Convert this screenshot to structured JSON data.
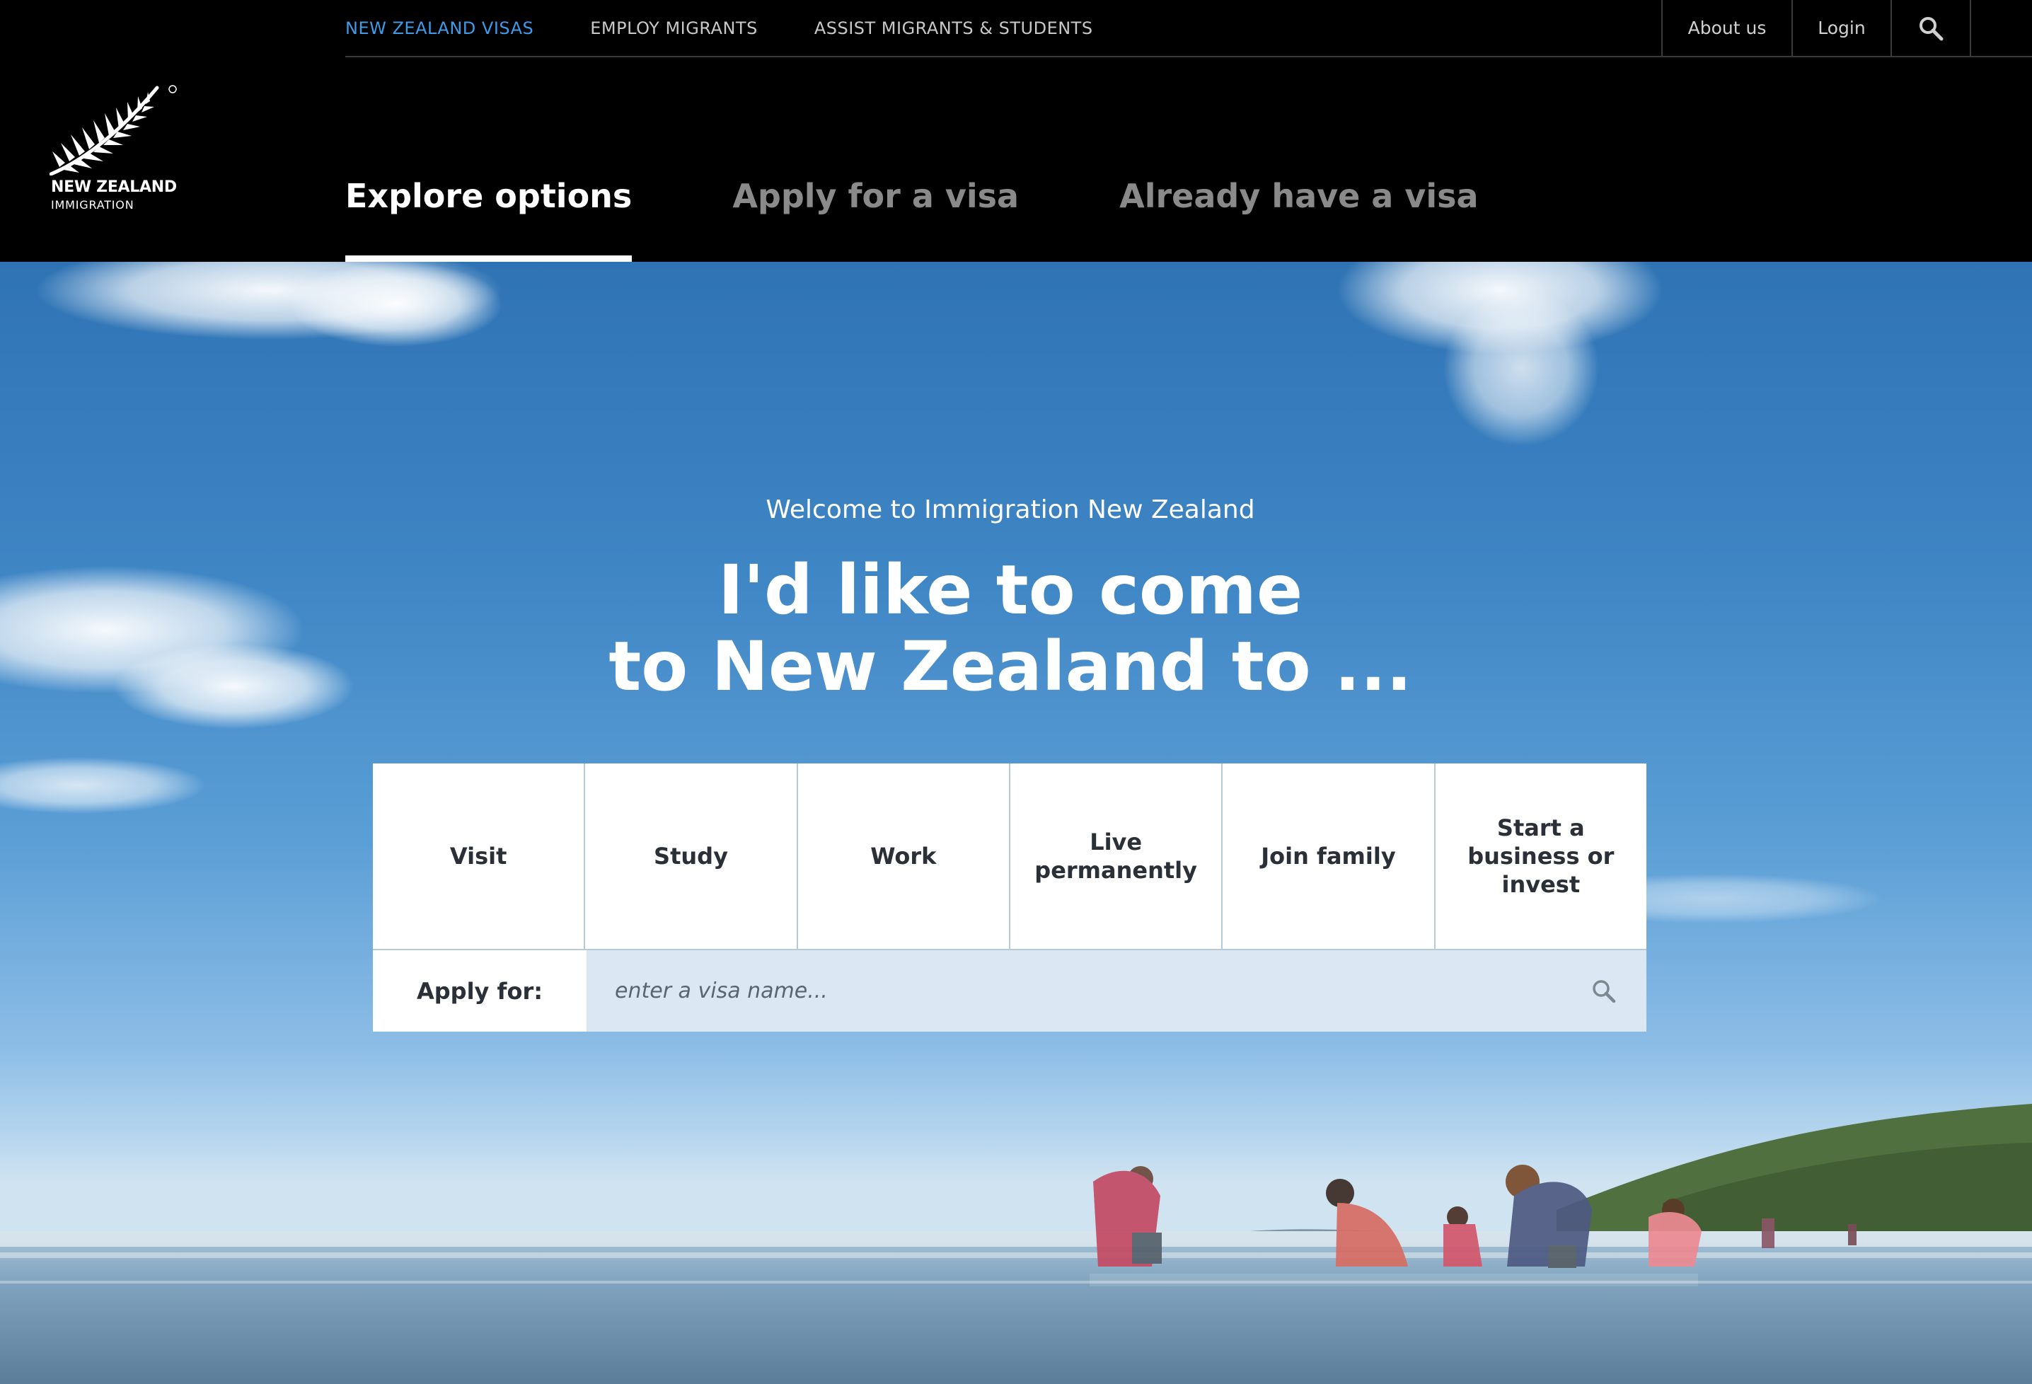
{
  "utility_nav": {
    "links": [
      "NEW ZEALAND VISAS",
      "EMPLOY MIGRANTS",
      "ASSIST MIGRANTS & STUDENTS"
    ],
    "about": "About us",
    "login": "Login",
    "search_icon": "search-icon",
    "active_color": "#3d9be9"
  },
  "logo": {
    "line1": "NEW ZEALAND",
    "line2": "IMMIGRATION",
    "icon": "silver-fern-icon"
  },
  "main_nav": {
    "tabs": [
      "Explore options",
      "Apply for a visa",
      "Already have a visa"
    ],
    "active": "Explore options"
  },
  "hero": {
    "welcome": "Welcome to Immigration New Zealand",
    "headline_line1": "I'd like to come",
    "headline_line2": "to New Zealand to ...",
    "options": [
      "Visit",
      "Study",
      "Work",
      "Live permanently",
      "Join family",
      "Start a business or invest"
    ],
    "apply_label": "Apply for:",
    "apply_placeholder": "enter a visa name...",
    "apply_search_icon": "search-icon"
  }
}
